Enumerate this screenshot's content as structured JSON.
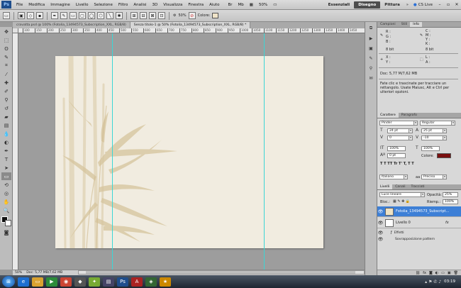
{
  "menu": {
    "items": [
      "File",
      "Modifica",
      "Immagine",
      "Livello",
      "Selezione",
      "Filtro",
      "Analisi",
      "3D",
      "Visualizza",
      "Finestra",
      "Aiuto"
    ],
    "zoom": "50%",
    "workspaces": [
      "Essenziali",
      "Disegno",
      "Pittura"
    ],
    "active_workspace": "Disegno",
    "cs_live": "CS Live",
    "more": "»"
  },
  "options": {
    "stile_value": "50%",
    "colore_label": "Colore:",
    "colore_swatch": "#efe3c8"
  },
  "doc_tabs": [
    "cravatta.psd @ 100% (Fotolia_13494573_Subscription_XXL, RGB/8)",
    "Senza titolo-1 @ 50% (Fotolia_13494573_Subscription_XXL, RGB/8) *"
  ],
  "ruler_ticks": [
    "100",
    "150",
    "200",
    "250",
    "300",
    "350",
    "400",
    "450",
    "500",
    "550",
    "600",
    "650",
    "700",
    "750",
    "800",
    "850",
    "900",
    "950",
    "1000",
    "1050",
    "1100",
    "1150",
    "1200",
    "1250",
    "1300",
    "1350",
    "1400",
    "1450"
  ],
  "status": {
    "zoom": "50%",
    "doc": "Doc: 5,77 MB/7,62 MB"
  },
  "info_panel": {
    "tabs": [
      "Campioni",
      "Stili",
      "Info"
    ],
    "active_tab": "Info",
    "r": "R :",
    "g": "G :",
    "b": "B :",
    "c": "C :",
    "m": "M :",
    "y": "Y :",
    "k": "K :",
    "bit1": "8 bit",
    "bit2": "8 bit",
    "x": "X :",
    "y2": "Y :",
    "w": "L :",
    "h": "A :",
    "doc": "Doc: 5,77 M/7,62 MB",
    "hint": "Fate clic e trascinate per tracciare un rettangolo. Usate Maiusc, Alt e Ctrl per ulteriori opzioni."
  },
  "char_panel": {
    "tabs": [
      "Carattere",
      "Paragrafo"
    ],
    "active_tab": "Carattere",
    "font_family": "Pinder",
    "font_style": "Regular",
    "size": "24 pt",
    "leading": "25 pt",
    "kerning": "0",
    "tracking": "-10",
    "v_scale": "100%",
    "h_scale": "100%",
    "baseline": "0 pt",
    "color_label": "Colore:",
    "color_value": "#7a1010",
    "language": "Italiano",
    "aa_label": "aa",
    "aa": "Preciso"
  },
  "layers_panel": {
    "tabs": [
      "Livelli",
      "Canali",
      "Tracciati"
    ],
    "active_tab": "Livelli",
    "blend_mode": "Luce lineare",
    "opacity_label": "Opacità:",
    "opacity": "25%",
    "lock_label": "Bloc.:",
    "fill_label": "Riemp.:",
    "fill": "100%",
    "layers": [
      {
        "name": "Fotolia_13494573_Subscript...",
        "selected": true
      },
      {
        "name": "Livello 0",
        "selected": false
      }
    ],
    "fx_label": "fx",
    "effects_label": "Effetti",
    "effect_item": "Sovrapposizione pattern"
  },
  "taskbar": {
    "clock": "03:19"
  },
  "colors": {
    "doc_bg": "#f1ece0",
    "bamboo": "#d8c7a0",
    "guide": "#3ad6d6",
    "selection": "#3d7fd6"
  }
}
